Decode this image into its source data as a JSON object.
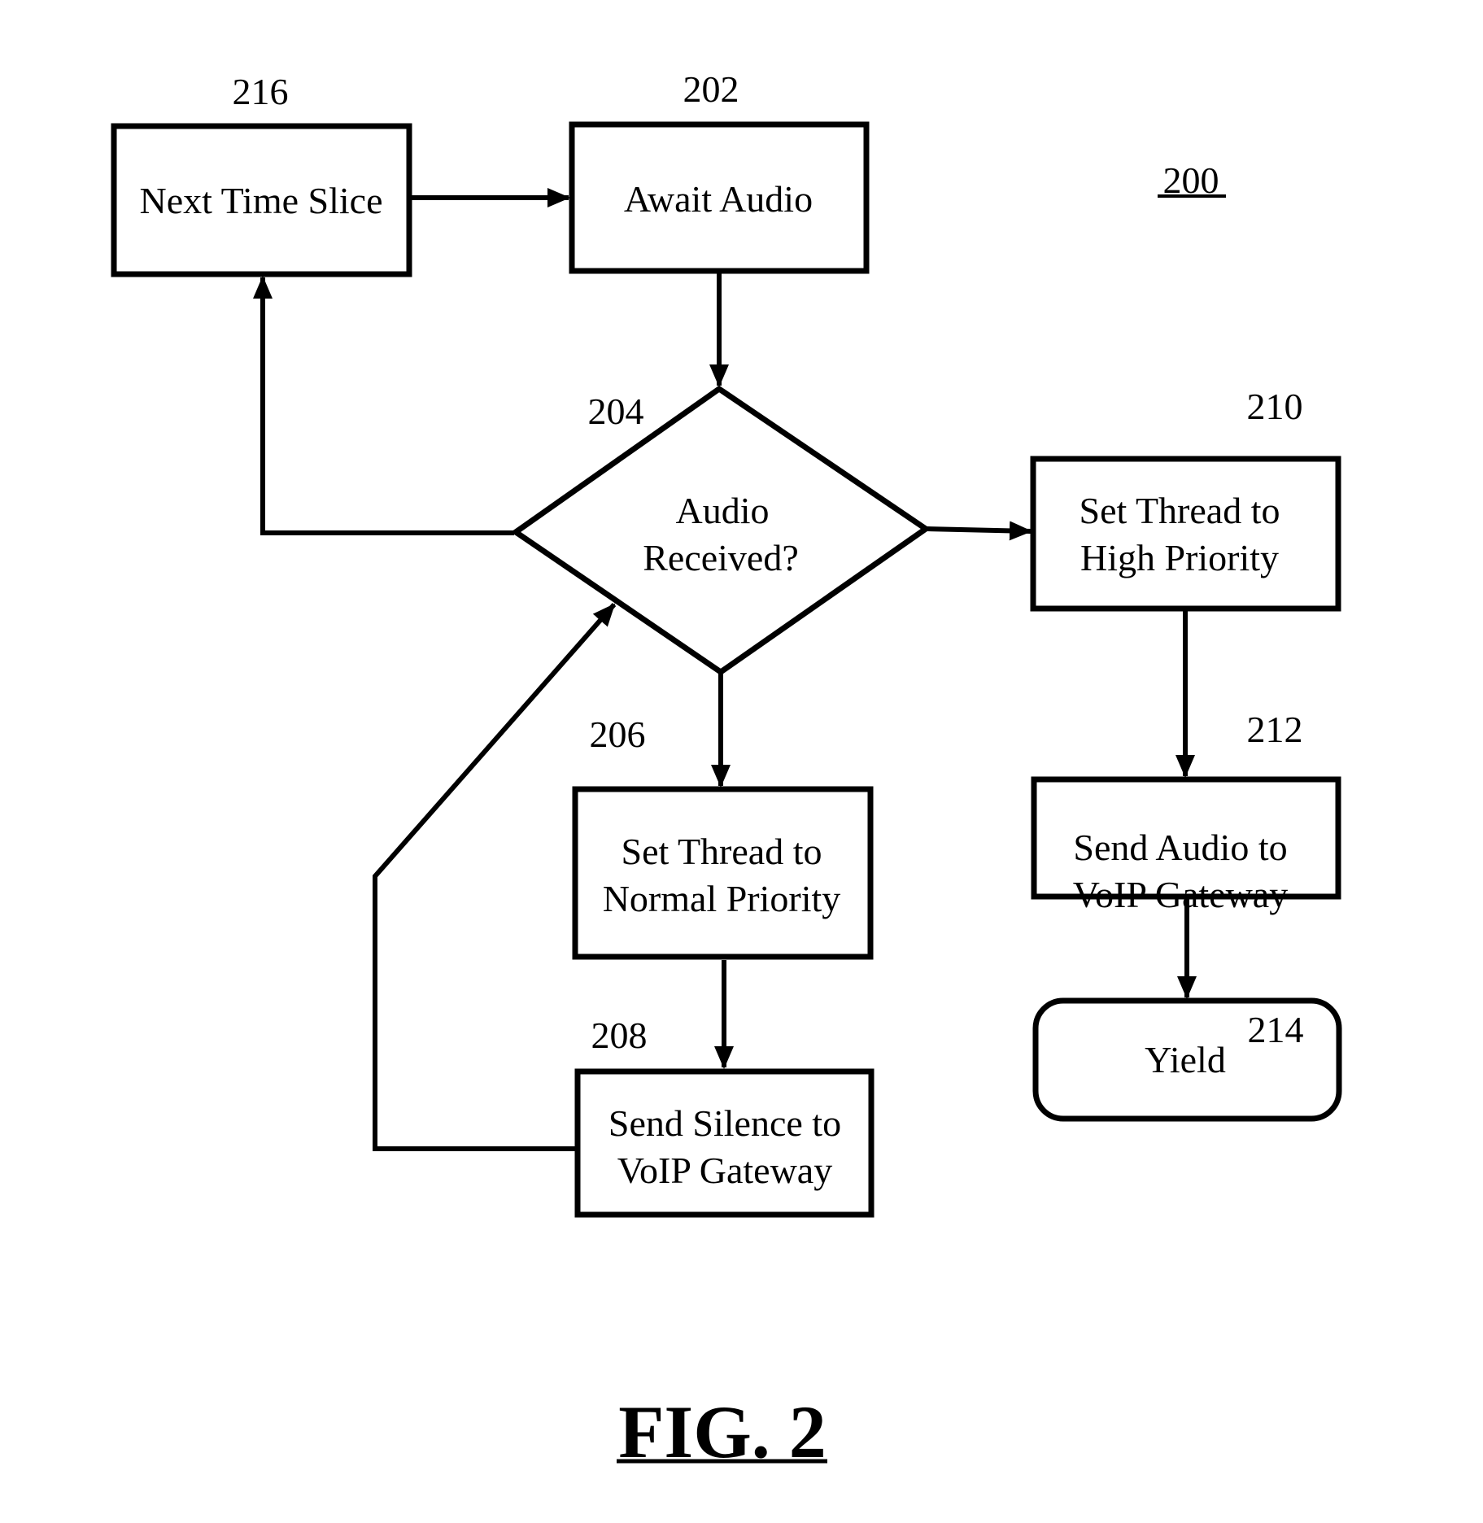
{
  "figure": {
    "title": "FIG. 2",
    "reference": "200"
  },
  "nodes": {
    "next_time_slice": {
      "ref": "216",
      "lines": [
        "Next Time Slice"
      ]
    },
    "await_audio": {
      "ref": "202",
      "lines": [
        "Await Audio"
      ]
    },
    "audio_received": {
      "ref": "204",
      "lines": [
        "Audio",
        "Received?"
      ]
    },
    "normal_priority": {
      "ref": "206",
      "lines": [
        "Set Thread to",
        "Normal Priority"
      ]
    },
    "send_silence": {
      "ref": "208",
      "lines": [
        "Send Silence to",
        "VoIP Gateway"
      ]
    },
    "high_priority": {
      "ref": "210",
      "lines": [
        "Set Thread to",
        "High Priority"
      ]
    },
    "send_audio": {
      "ref": "212",
      "lines": [
        "Send Audio to",
        "VoIP Gateway"
      ]
    },
    "yield": {
      "ref": "214",
      "lines": [
        "Yield"
      ]
    }
  },
  "edges": [
    {
      "from": "216",
      "to": "202"
    },
    {
      "from": "202",
      "to": "204"
    },
    {
      "from": "204",
      "to": "216",
      "branch": "left"
    },
    {
      "from": "204",
      "to": "210",
      "branch": "right"
    },
    {
      "from": "204",
      "to": "206",
      "branch": "down"
    },
    {
      "from": "206",
      "to": "208"
    },
    {
      "from": "208",
      "to": "204"
    },
    {
      "from": "210",
      "to": "212"
    },
    {
      "from": "212",
      "to": "214"
    }
  ]
}
